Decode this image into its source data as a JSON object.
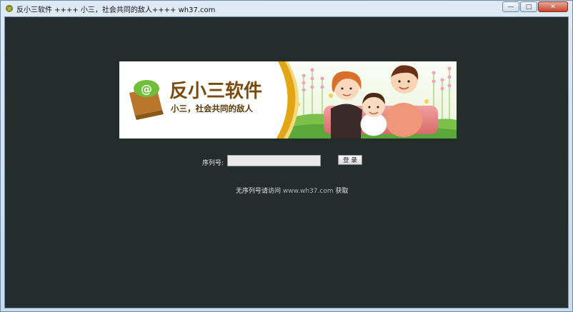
{
  "window": {
    "title": "反小三软件 ++++ 小三，社会共同的敌人++++ wh37.com",
    "minimize_glyph": "—",
    "maximize_glyph": "□",
    "close_glyph": "✕"
  },
  "banner": {
    "title": "反小三软件",
    "slogan": "小三，社会共同的敌人",
    "logo_icon": "at-sign-box-icon"
  },
  "form": {
    "serial_label": "序列号:",
    "serial_value": "",
    "login_button": "登 录"
  },
  "notice": {
    "prefix": "无序列号请访问",
    "link": "www.wh37.com",
    "suffix": "获取"
  },
  "colors": {
    "background": "#232d2c",
    "banner_title": "#7a4a0c",
    "banner_slogan": "#5a3a08",
    "gold_ribbon": "#e2a614"
  }
}
